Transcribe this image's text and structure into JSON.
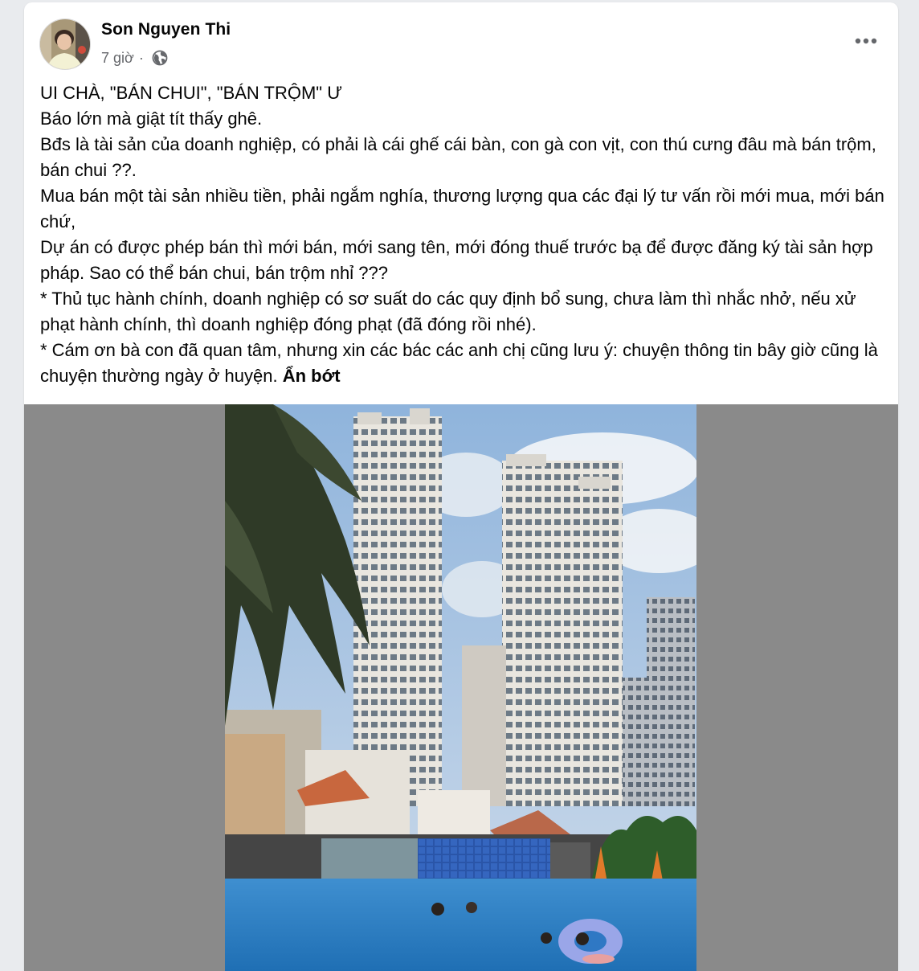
{
  "post": {
    "author": "Son Nguyen Thi",
    "time": "7 giờ",
    "separator": "·",
    "audience_icon": "globe-icon",
    "more_icon": "more-horizontal-icon",
    "lines": [
      "UI CHÀ, \"BÁN CHUI\", \"BÁN TRỘM\" Ư",
      "Báo lớn mà giật tít thấy ghê.",
      "Bđs là tài sản của doanh nghiệp, có phải là cái ghế cái bàn, con gà con vịt, con thú cưng đâu mà bán trộm, bán chui ??.",
      "Mua bán một tài sản nhiều tiền, phải ngắm nghía, thương lượng qua các đại lý tư vấn rồi mới mua, mới bán chứ,",
      "Dự án có được phép bán thì mới bán, mới sang tên, mới đóng thuế trước bạ để được đăng ký tài sản hợp pháp. Sao có thể bán chui, bán trộm nhỉ ???",
      "* Thủ tục hành chính, doanh nghiệp có sơ suất do các quy định bổ sung, chưa làm thì nhắc nhở, nếu xử phạt hành chính, thì doanh nghiệp đóng phạt (đã đóng rồi nhé).",
      "* Cám ơn bà con đã quan tâm, nhưng xin các bác các anh chị cũng lưu ý: chuyện thông tin bây giờ cũng là chuyện thường ngày ở huyện."
    ],
    "see_less_label": "Ẩn bớt"
  },
  "colors": {
    "name_text": "#050505",
    "meta_text": "#65676b",
    "media_backdrop": "#8a8a8a",
    "page_bg": "#e9ebee"
  }
}
